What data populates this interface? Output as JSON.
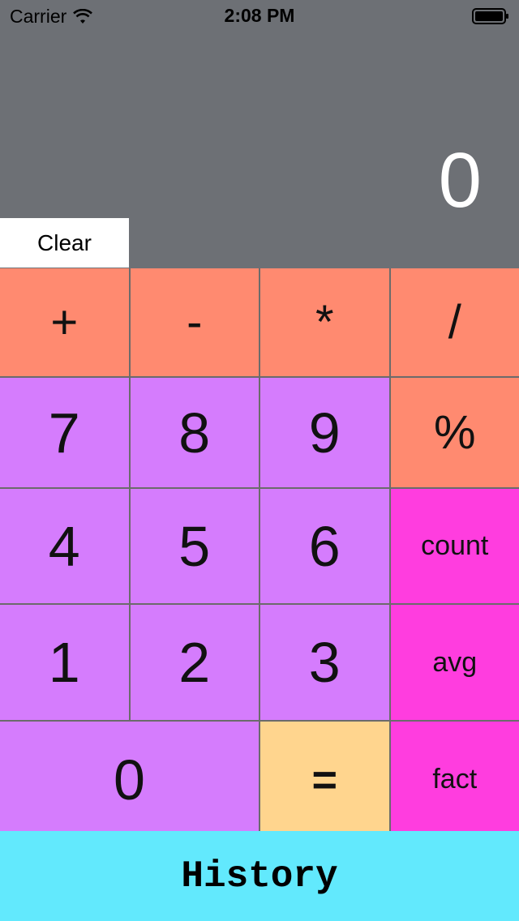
{
  "status_bar": {
    "carrier": "Carrier",
    "time": "2:08 PM",
    "wifi_icon": "wifi-icon",
    "battery_icon": "battery-icon"
  },
  "display": {
    "value": "0"
  },
  "clear_label": "Clear",
  "keys": {
    "plus": "+",
    "minus": "-",
    "multiply": "*",
    "divide": "/",
    "seven": "7",
    "eight": "8",
    "nine": "9",
    "percent": "%",
    "four": "4",
    "five": "5",
    "six": "6",
    "count": "count",
    "one": "1",
    "two": "2",
    "three": "3",
    "avg": "avg",
    "zero": "0",
    "equals": "=",
    "fact": "fact"
  },
  "history_label": "History",
  "colors": {
    "background": "#6d7075",
    "operator": "#ff8a70",
    "number": "#d57cfd",
    "function": "#ff3ddf",
    "equals": "#ffd58e",
    "history": "#62e9fd"
  }
}
